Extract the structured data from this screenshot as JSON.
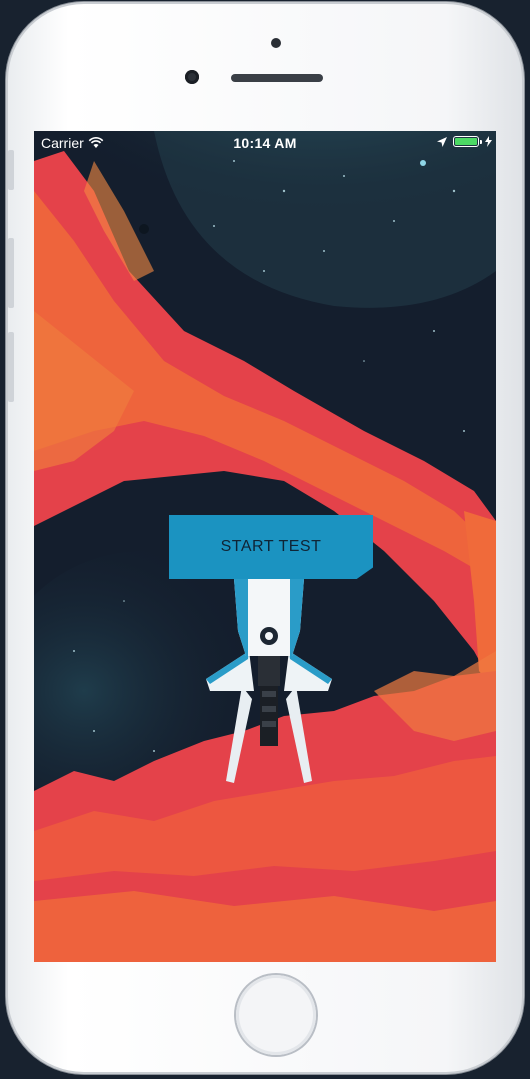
{
  "status_bar": {
    "carrier": "Carrier",
    "time": "10:14 AM"
  },
  "main": {
    "start_button_label": "START TEST"
  },
  "colors": {
    "sky": "#141e2d",
    "rock_red": "#e4424a",
    "rock_orange": "#f06a3a",
    "button": "#1b93c1",
    "battery": "#4cd964"
  },
  "icons": [
    "wifi-icon",
    "location-arrow-icon",
    "battery-icon",
    "charging-bolt-icon"
  ]
}
